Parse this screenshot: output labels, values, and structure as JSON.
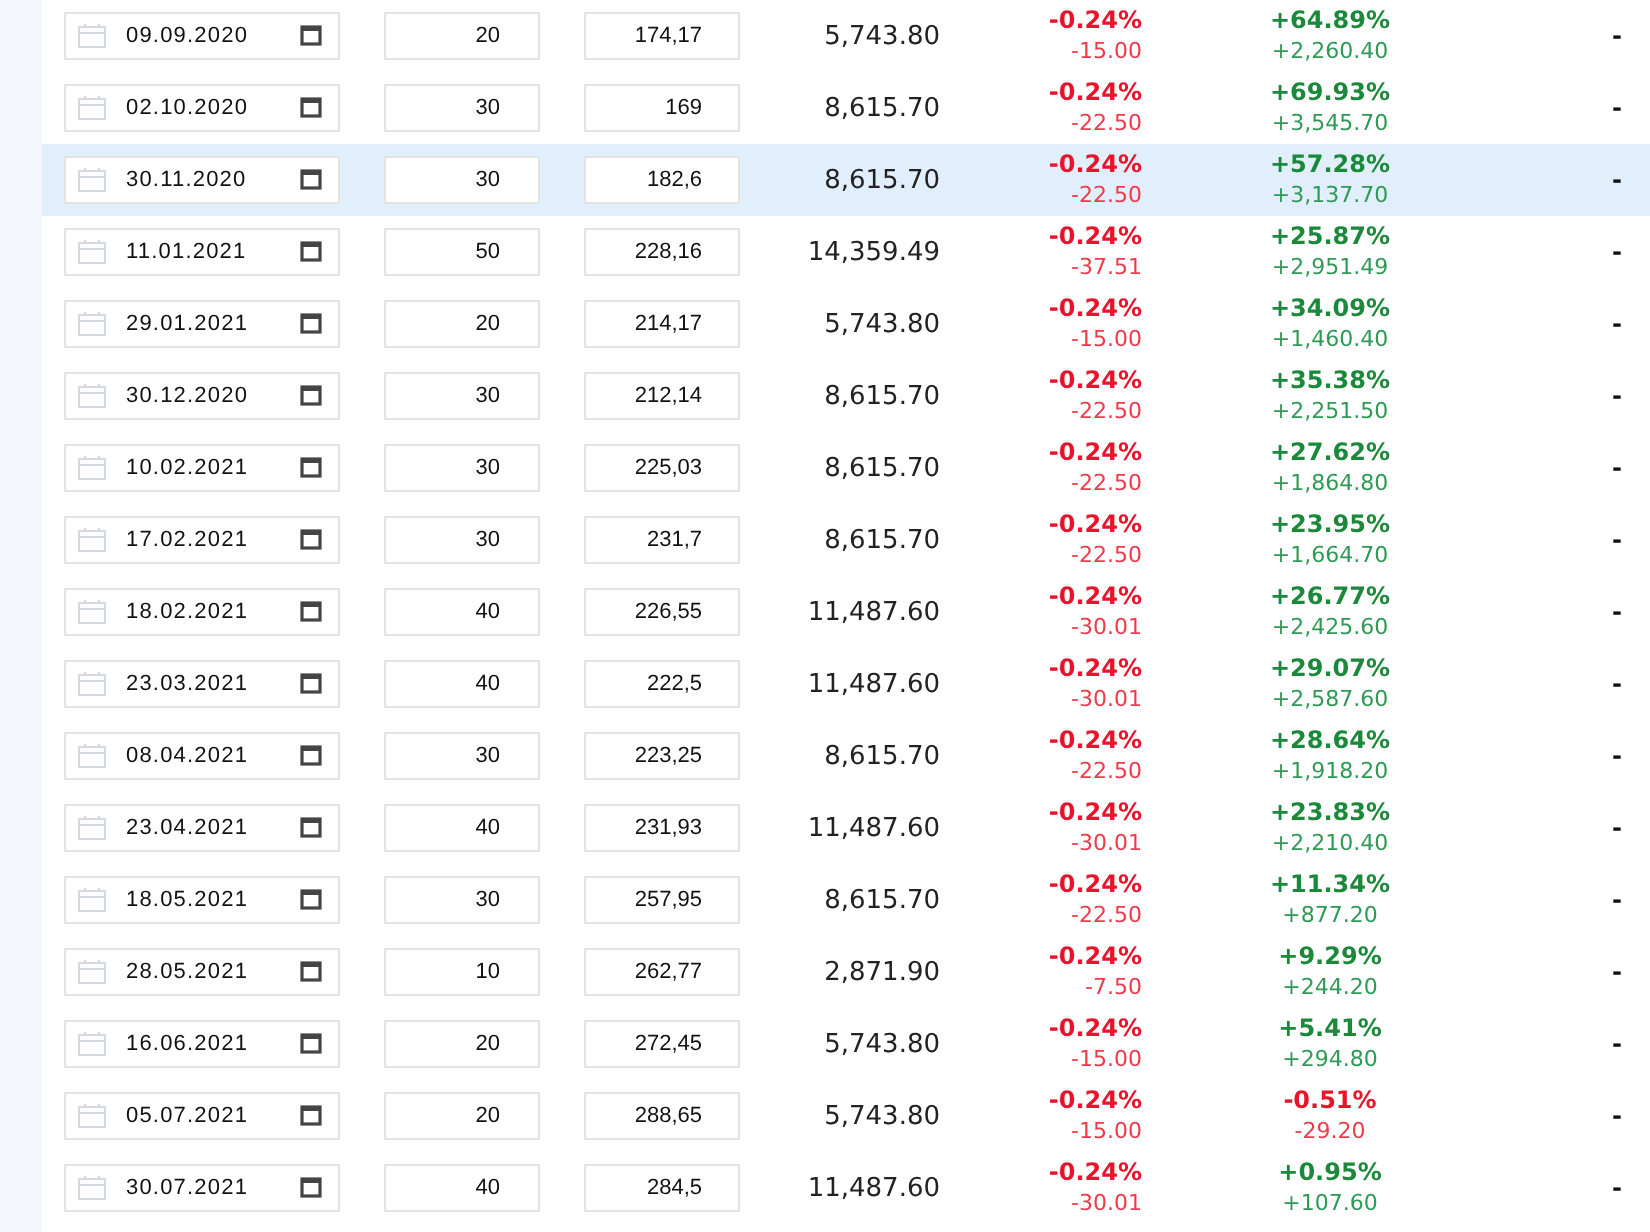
{
  "rows": [
    {
      "date": "09.09.2020",
      "quantity": "20",
      "price": "174,17",
      "amount": "5,743.80",
      "fee": {
        "percent": "-0.24%",
        "value": "-15.00",
        "positive": false
      },
      "result": {
        "percent": "+64.89%",
        "value": "+2,260.40",
        "positive": true
      },
      "column_8": "-",
      "selected": false
    },
    {
      "date": "02.10.2020",
      "quantity": "30",
      "price": "169",
      "amount": "8,615.70",
      "fee": {
        "percent": "-0.24%",
        "value": "-22.50",
        "positive": false
      },
      "result": {
        "percent": "+69.93%",
        "value": "+3,545.70",
        "positive": true
      },
      "column_8": "-",
      "selected": false
    },
    {
      "date": "30.11.2020",
      "quantity": "30",
      "price": "182,6",
      "amount": "8,615.70",
      "fee": {
        "percent": "-0.24%",
        "value": "-22.50",
        "positive": false
      },
      "result": {
        "percent": "+57.28%",
        "value": "+3,137.70",
        "positive": true
      },
      "column_8": "-",
      "selected": true
    },
    {
      "date": "11.01.2021",
      "quantity": "50",
      "price": "228,16",
      "amount": "14,359.49",
      "fee": {
        "percent": "-0.24%",
        "value": "-37.51",
        "positive": false
      },
      "result": {
        "percent": "+25.87%",
        "value": "+2,951.49",
        "positive": true
      },
      "column_8": "-",
      "selected": false
    },
    {
      "date": "29.01.2021",
      "quantity": "20",
      "price": "214,17",
      "amount": "5,743.80",
      "fee": {
        "percent": "-0.24%",
        "value": "-15.00",
        "positive": false
      },
      "result": {
        "percent": "+34.09%",
        "value": "+1,460.40",
        "positive": true
      },
      "column_8": "-",
      "selected": false
    },
    {
      "date": "30.12.2020",
      "quantity": "30",
      "price": "212,14",
      "amount": "8,615.70",
      "fee": {
        "percent": "-0.24%",
        "value": "-22.50",
        "positive": false
      },
      "result": {
        "percent": "+35.38%",
        "value": "+2,251.50",
        "positive": true
      },
      "column_8": "-",
      "selected": false
    },
    {
      "date": "10.02.2021",
      "quantity": "30",
      "price": "225,03",
      "amount": "8,615.70",
      "fee": {
        "percent": "-0.24%",
        "value": "-22.50",
        "positive": false
      },
      "result": {
        "percent": "+27.62%",
        "value": "+1,864.80",
        "positive": true
      },
      "column_8": "-",
      "selected": false
    },
    {
      "date": "17.02.2021",
      "quantity": "30",
      "price": "231,7",
      "amount": "8,615.70",
      "fee": {
        "percent": "-0.24%",
        "value": "-22.50",
        "positive": false
      },
      "result": {
        "percent": "+23.95%",
        "value": "+1,664.70",
        "positive": true
      },
      "column_8": "-",
      "selected": false
    },
    {
      "date": "18.02.2021",
      "quantity": "40",
      "price": "226,55",
      "amount": "11,487.60",
      "fee": {
        "percent": "-0.24%",
        "value": "-30.01",
        "positive": false
      },
      "result": {
        "percent": "+26.77%",
        "value": "+2,425.60",
        "positive": true
      },
      "column_8": "-",
      "selected": false
    },
    {
      "date": "23.03.2021",
      "quantity": "40",
      "price": "222,5",
      "amount": "11,487.60",
      "fee": {
        "percent": "-0.24%",
        "value": "-30.01",
        "positive": false
      },
      "result": {
        "percent": "+29.07%",
        "value": "+2,587.60",
        "positive": true
      },
      "column_8": "-",
      "selected": false
    },
    {
      "date": "08.04.2021",
      "quantity": "30",
      "price": "223,25",
      "amount": "8,615.70",
      "fee": {
        "percent": "-0.24%",
        "value": "-22.50",
        "positive": false
      },
      "result": {
        "percent": "+28.64%",
        "value": "+1,918.20",
        "positive": true
      },
      "column_8": "-",
      "selected": false
    },
    {
      "date": "23.04.2021",
      "quantity": "40",
      "price": "231,93",
      "amount": "11,487.60",
      "fee": {
        "percent": "-0.24%",
        "value": "-30.01",
        "positive": false
      },
      "result": {
        "percent": "+23.83%",
        "value": "+2,210.40",
        "positive": true
      },
      "column_8": "-",
      "selected": false
    },
    {
      "date": "18.05.2021",
      "quantity": "30",
      "price": "257,95",
      "amount": "8,615.70",
      "fee": {
        "percent": "-0.24%",
        "value": "-22.50",
        "positive": false
      },
      "result": {
        "percent": "+11.34%",
        "value": "+877.20",
        "positive": true
      },
      "column_8": "-",
      "selected": false
    },
    {
      "date": "28.05.2021",
      "quantity": "10",
      "price": "262,77",
      "amount": "2,871.90",
      "fee": {
        "percent": "-0.24%",
        "value": "-7.50",
        "positive": false
      },
      "result": {
        "percent": "+9.29%",
        "value": "+244.20",
        "positive": true
      },
      "column_8": "-",
      "selected": false
    },
    {
      "date": "16.06.2021",
      "quantity": "20",
      "price": "272,45",
      "amount": "5,743.80",
      "fee": {
        "percent": "-0.24%",
        "value": "-15.00",
        "positive": false
      },
      "result": {
        "percent": "+5.41%",
        "value": "+294.80",
        "positive": true
      },
      "column_8": "-",
      "selected": false
    },
    {
      "date": "05.07.2021",
      "quantity": "20",
      "price": "288,65",
      "amount": "5,743.80",
      "fee": {
        "percent": "-0.24%",
        "value": "-15.00",
        "positive": false
      },
      "result": {
        "percent": "-0.51%",
        "value": "-29.20",
        "positive": false
      },
      "column_8": "-",
      "selected": false
    },
    {
      "date": "30.07.2021",
      "quantity": "40",
      "price": "284,5",
      "amount": "11,487.60",
      "fee": {
        "percent": "-0.24%",
        "value": "-30.01",
        "positive": false
      },
      "result": {
        "percent": "+0.95%",
        "value": "+107.60",
        "positive": true
      },
      "column_8": "-",
      "selected": false
    }
  ]
}
